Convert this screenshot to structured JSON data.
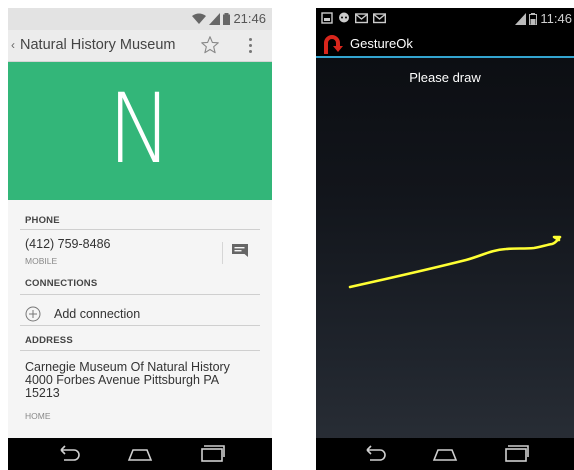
{
  "left_phone": {
    "status_bar": {
      "time": "21:46"
    },
    "action_bar": {
      "title": "Natural History Museum"
    },
    "hero": {
      "letter": "N",
      "color": "#33b679"
    },
    "sections": {
      "phone_header": "PHONE",
      "phone_number": "(412) 759-8486",
      "phone_type": "MOBILE",
      "connections_header": "CONNECTIONS",
      "add_connection": "Add connection",
      "address_header": "ADDRESS",
      "address_line1": "Carnegie Museum Of Natural History",
      "address_line2": "4000 Forbes Avenue Pittsburgh PA",
      "address_line3": "15213",
      "address_type": "HOME"
    }
  },
  "right_phone": {
    "status_bar": {
      "time": "11:46"
    },
    "action_bar": {
      "title": "GestureOk"
    },
    "canvas": {
      "prompt": "Please draw",
      "stroke_color": "#ffff33"
    },
    "accent_color": "#33a4cf"
  },
  "icons": {
    "star": "star-outline-icon",
    "overflow": "overflow-menu-icon",
    "message": "message-icon",
    "add": "add-circle-icon",
    "back": "back-icon",
    "home": "home-icon",
    "recents": "recents-icon"
  }
}
